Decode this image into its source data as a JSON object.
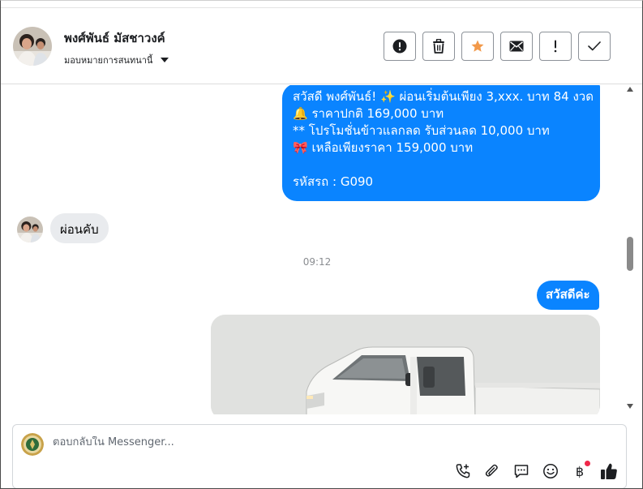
{
  "header": {
    "contact_name": "พงศ์พันธ์ มัสชาวงค์",
    "assign_label": "มอบหมายการสนทนานี้"
  },
  "toolbar": {
    "buttons": [
      {
        "icon": "alert-circle-icon",
        "color": "#1c1e21"
      },
      {
        "icon": "trash-icon",
        "color": "#1c1e21"
      },
      {
        "icon": "star-icon",
        "color": "#f2994a"
      },
      {
        "icon": "envelope-icon",
        "color": "#1c1e21"
      },
      {
        "icon": "exclamation-icon",
        "color": "#1c1e21"
      },
      {
        "icon": "check-icon",
        "color": "#1c1e21"
      }
    ]
  },
  "messages": {
    "promo_lines": [
      "สวัสดี พงศ์พันธ์! ✨  ผ่อนเริ่มต้นเพียง 3,xxx. บาท 84 งวด",
      "🔔 ราคาปกติ 169,000 บาท",
      "** โปรโมชั่นข้าวแลกลด รับส่วนลด 10,000 บาท",
      "🎀  เหลือเพียงราคา 159,000 บาท",
      "",
      " รหัสรถ : G090"
    ],
    "incoming_text": "ผ่อนคับ",
    "timestamp": "09:12",
    "outgoing_hello": "สวัสดีค่ะ"
  },
  "composer": {
    "placeholder": "ตอบกลับใน Messenger...",
    "actions": [
      "add-call-icon",
      "attachment-icon",
      "saved-reply-icon",
      "emoji-icon",
      "baht-payment-icon",
      "thumbs-up-icon"
    ],
    "baht_symbol": "฿"
  },
  "colors": {
    "outgoing_bubble": "#0a84ff",
    "incoming_bubble": "#e9ebee",
    "star": "#f2994a",
    "notification_dot": "#f02849"
  }
}
